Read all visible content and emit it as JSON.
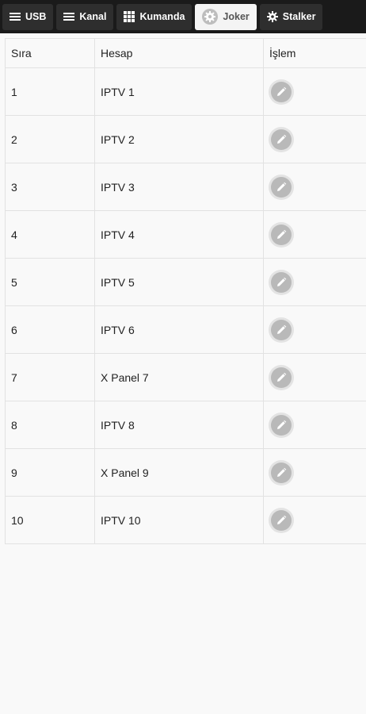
{
  "tabs": [
    {
      "label": "USB",
      "icon": "list-icon",
      "active": false
    },
    {
      "label": "Kanal",
      "icon": "list-icon",
      "active": false
    },
    {
      "label": "Kumanda",
      "icon": "grid-icon",
      "active": false
    },
    {
      "label": "Joker",
      "icon": "gear-icon",
      "active": true
    },
    {
      "label": "Stalker",
      "icon": "gear-icon",
      "active": false
    }
  ],
  "table": {
    "headers": [
      "Sıra",
      "Hesap",
      "İşlem"
    ],
    "rows": [
      {
        "no": "1",
        "account": "IPTV 1"
      },
      {
        "no": "2",
        "account": "IPTV 2"
      },
      {
        "no": "3",
        "account": "IPTV 3"
      },
      {
        "no": "4",
        "account": "IPTV 4"
      },
      {
        "no": "5",
        "account": "IPTV 5"
      },
      {
        "no": "6",
        "account": "IPTV 6"
      },
      {
        "no": "7",
        "account": "X Panel 7"
      },
      {
        "no": "8",
        "account": "IPTV 8"
      },
      {
        "no": "9",
        "account": "X Panel 9"
      },
      {
        "no": "10",
        "account": "IPTV 10"
      }
    ],
    "action_icon": "pencil-icon"
  },
  "colors": {
    "topbar": "#1a1a1a",
    "tab": "#2e2e2e",
    "tab_active": "#f4f4f4",
    "page_background": "#f9f9f9",
    "edit_button": "#b9b9b9"
  }
}
